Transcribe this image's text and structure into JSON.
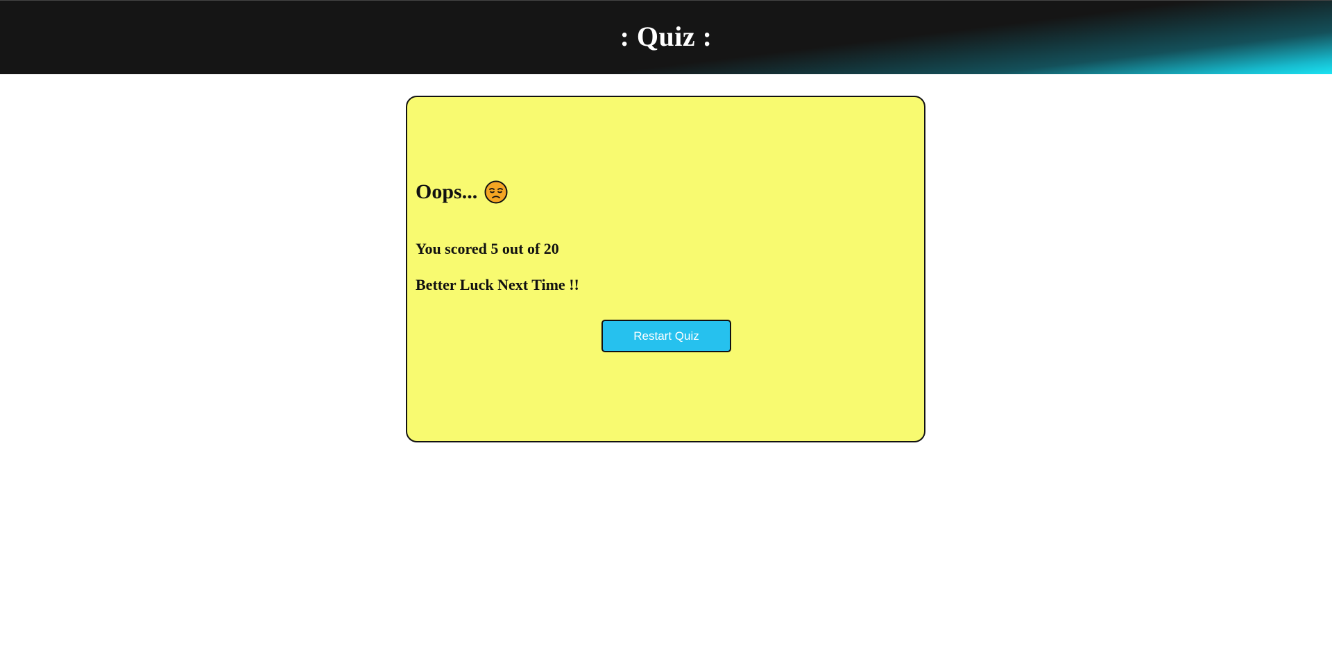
{
  "header": {
    "title": ": Quiz :"
  },
  "result": {
    "heading": "Oops...",
    "heading_icon": "sad-face-emoji",
    "score_text": "You scored 5 out of 20",
    "message": "Better Luck Next Time !!",
    "restart_label": "Restart Quiz"
  },
  "colors": {
    "header_dark": "#151515",
    "header_accent": "#1be3f3",
    "card_background": "#f8fa70",
    "button_background": "#26c1ee",
    "emoji_fill": "#f5a623"
  }
}
